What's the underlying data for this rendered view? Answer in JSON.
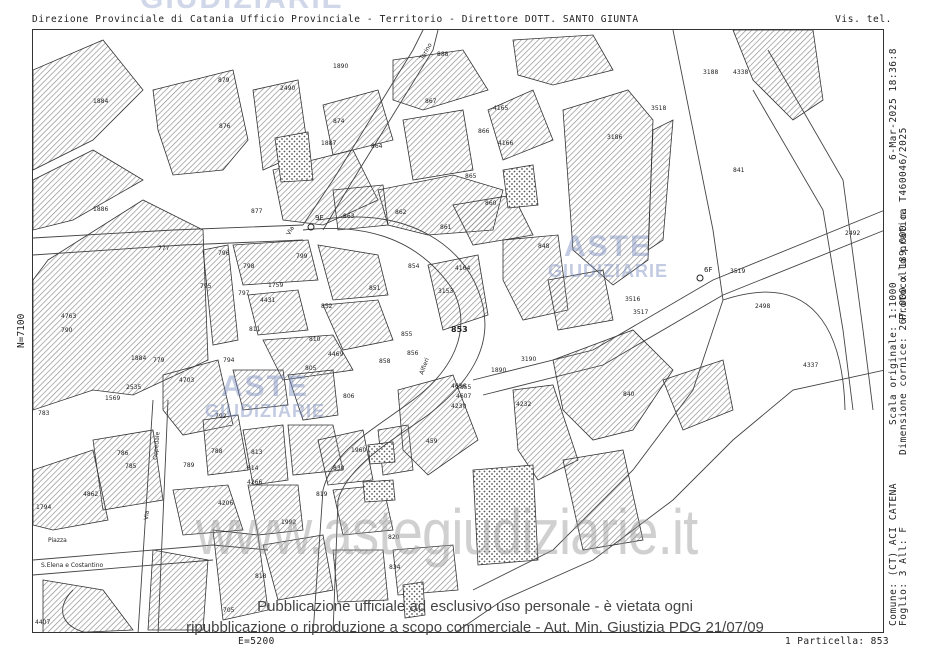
{
  "header": {
    "left": "Direzione Provinciale di Catania  Ufficio Provinciale - Territorio - Direttore DOTT. SANTO GIUNTA",
    "right": "Vis. tel."
  },
  "side_right": {
    "line1": "6-Mar-2025 18:36:8",
    "line2": "Protocollo pratica T460046/2025",
    "line3": "Scala originale: 1:1000",
    "line4": "Dimensione cornice: 267.000 x 189.000 m.",
    "line5": "Comune: (CT) ACI CATENA",
    "line6": "Foglio: 3 All: F"
  },
  "coords": {
    "north": "N=7100",
    "east": "E=5200",
    "particella": "1 Particella: 853"
  },
  "watermark": {
    "top": "GIUDIZIARIE",
    "aste": "ASTE",
    "giudiziarie": "GIUDIZIARIE",
    "site": "www.astegiudiziarie.it"
  },
  "notice": {
    "line1": "Pubblicazione ufficiale ad esclusivo uso personale - è vietata ogni",
    "line2": "ripubblicazione o riproduzione a scopo commerciale - Aut. Min. Giustizia PDG 21/07/09"
  },
  "streets": {
    "piazza": "Piazza",
    "piazza2": "S.Elena e Costantino",
    "via1": "Via",
    "via2": "Ospedale",
    "alfieri": "Alfieri",
    "via3": "Via",
    "via4": "Torino"
  },
  "parcels": [
    {
      "id": "p1890",
      "label": "1890"
    },
    {
      "id": "p2490",
      "label": "2490"
    },
    {
      "id": "p879",
      "label": "879"
    },
    {
      "id": "p876",
      "label": "876"
    },
    {
      "id": "p877",
      "label": "877"
    },
    {
      "id": "p1884",
      "label": "1884"
    },
    {
      "id": "p1886",
      "label": "1886"
    },
    {
      "id": "p777",
      "label": "777"
    },
    {
      "id": "p874",
      "label": "874"
    },
    {
      "id": "p1887",
      "label": "1887"
    },
    {
      "id": "p864",
      "label": "864"
    },
    {
      "id": "p867",
      "label": "867"
    },
    {
      "id": "p866",
      "label": "866"
    },
    {
      "id": "p865",
      "label": "865"
    },
    {
      "id": "p863",
      "label": "863"
    },
    {
      "id": "p862",
      "label": "862"
    },
    {
      "id": "p861",
      "label": "861"
    },
    {
      "id": "p860",
      "label": "860"
    },
    {
      "id": "p4165",
      "label": "4165"
    },
    {
      "id": "p4166",
      "label": "4166"
    },
    {
      "id": "p888",
      "label": "888"
    },
    {
      "id": "p3186",
      "label": "3186"
    },
    {
      "id": "p3188",
      "label": "3188"
    },
    {
      "id": "p4338",
      "label": "4338"
    },
    {
      "id": "p3518",
      "label": "3518"
    },
    {
      "id": "p841",
      "label": "841"
    },
    {
      "id": "p2492",
      "label": "2492"
    },
    {
      "id": "p2498",
      "label": "2498"
    },
    {
      "id": "p4337",
      "label": "4337"
    },
    {
      "id": "p3519",
      "label": "3519"
    },
    {
      "id": "p848",
      "label": "848"
    },
    {
      "id": "p4164",
      "label": "4164"
    },
    {
      "id": "p3153",
      "label": "3153"
    },
    {
      "id": "p853",
      "label": "853"
    },
    {
      "id": "p854",
      "label": "854"
    },
    {
      "id": "p852",
      "label": "852"
    },
    {
      "id": "p851",
      "label": "851"
    },
    {
      "id": "p855",
      "label": "855"
    },
    {
      "id": "p856",
      "label": "856"
    },
    {
      "id": "p858",
      "label": "858"
    },
    {
      "id": "p799",
      "label": "799"
    },
    {
      "id": "p796",
      "label": "796"
    },
    {
      "id": "p798",
      "label": "798"
    },
    {
      "id": "p795",
      "label": "795"
    },
    {
      "id": "p797",
      "label": "797"
    },
    {
      "id": "p1759",
      "label": "1759"
    },
    {
      "id": "p4431",
      "label": "4431"
    },
    {
      "id": "p811",
      "label": "811"
    },
    {
      "id": "p810",
      "label": "810"
    },
    {
      "id": "p4469",
      "label": "4469"
    },
    {
      "id": "p805",
      "label": "805"
    },
    {
      "id": "p806",
      "label": "806"
    },
    {
      "id": "p794",
      "label": "794"
    },
    {
      "id": "p4763",
      "label": "4763"
    },
    {
      "id": "p790",
      "label": "790"
    },
    {
      "id": "p1884b",
      "label": "1884"
    },
    {
      "id": "p779",
      "label": "779"
    },
    {
      "id": "p2535",
      "label": "2535"
    },
    {
      "id": "p783",
      "label": "783"
    },
    {
      "id": "p1569",
      "label": "1569"
    },
    {
      "id": "p4703",
      "label": "4703"
    },
    {
      "id": "p792",
      "label": "792"
    },
    {
      "id": "p788",
      "label": "788"
    },
    {
      "id": "p789",
      "label": "789"
    },
    {
      "id": "p786",
      "label": "786"
    },
    {
      "id": "p785",
      "label": "785"
    },
    {
      "id": "p4862",
      "label": "4862"
    },
    {
      "id": "p1794",
      "label": "1794"
    },
    {
      "id": "p813",
      "label": "813"
    },
    {
      "id": "p814",
      "label": "814"
    },
    {
      "id": "p4266",
      "label": "4266"
    },
    {
      "id": "p4206",
      "label": "4206"
    },
    {
      "id": "p1960",
      "label": "1960"
    },
    {
      "id": "p830",
      "label": "830"
    },
    {
      "id": "p819",
      "label": "819"
    },
    {
      "id": "p4232",
      "label": "4232"
    },
    {
      "id": "p4230",
      "label": "4230"
    },
    {
      "id": "p840",
      "label": "840"
    },
    {
      "id": "p1890b",
      "label": "1890"
    },
    {
      "id": "p3190",
      "label": "3190"
    },
    {
      "id": "p3516",
      "label": "3516"
    },
    {
      "id": "p3517",
      "label": "3517"
    },
    {
      "id": "p459",
      "label": "459"
    },
    {
      "id": "p1855",
      "label": "1855"
    },
    {
      "id": "p4607",
      "label": "4607"
    },
    {
      "id": "p4656",
      "label": "4656"
    },
    {
      "id": "p834",
      "label": "834"
    },
    {
      "id": "p818",
      "label": "818"
    },
    {
      "id": "p705",
      "label": "705"
    },
    {
      "id": "p4407",
      "label": "4407"
    },
    {
      "id": "p1992",
      "label": "1992"
    },
    {
      "id": "p820",
      "label": "820"
    }
  ],
  "markers": {
    "m1": "9F",
    "m2": "6F"
  }
}
